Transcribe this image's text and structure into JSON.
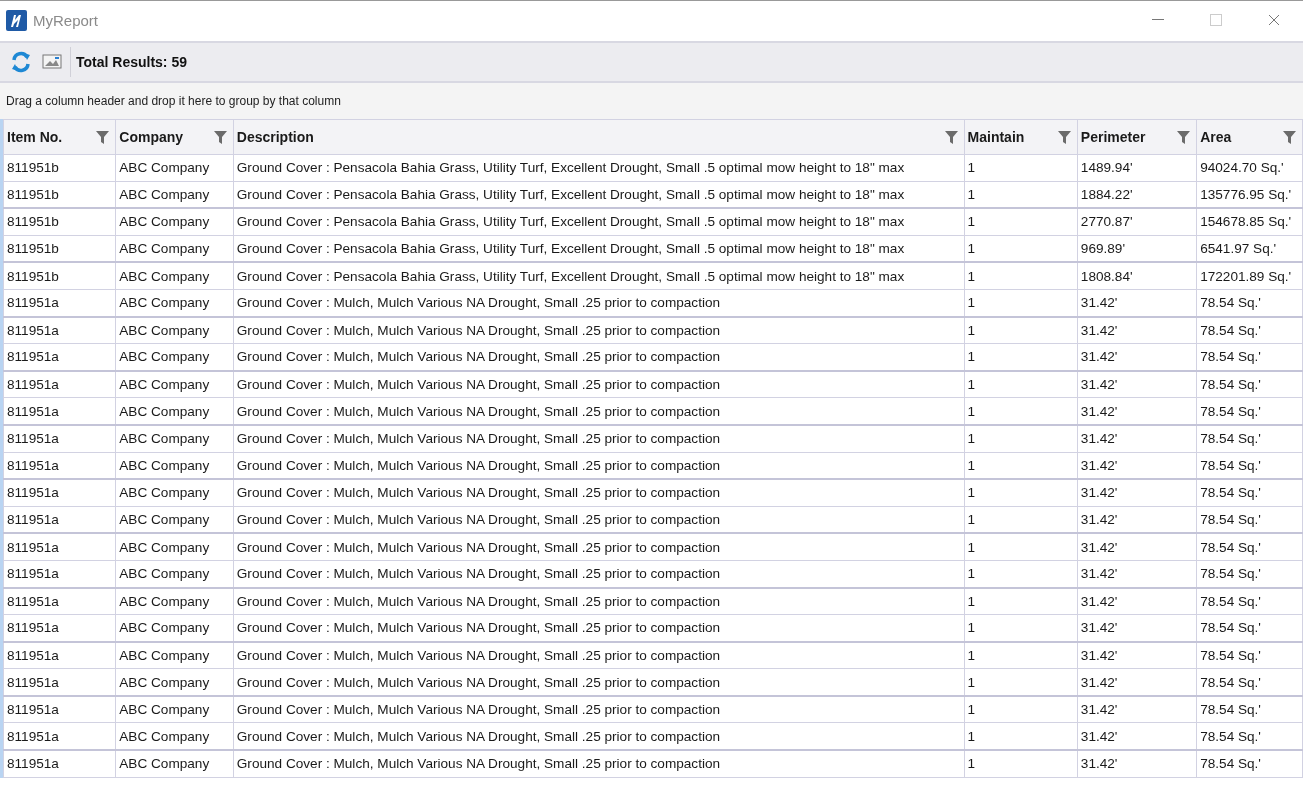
{
  "window": {
    "title": "MyReport"
  },
  "toolbar": {
    "total_results": "Total Results: 59"
  },
  "group_panel": {
    "hint": "Drag a column header and drop it here to group by that column"
  },
  "table": {
    "columns": [
      "Item No.",
      "Company",
      "Description",
      "Maintain",
      "Perimeter",
      "Area"
    ],
    "rows": [
      [
        "811951b",
        "ABC Company",
        "Ground Cover : Pensacola Bahia Grass, Utility Turf, Excellent Drought, Small .5 optimal mow height to 18\" max",
        "1",
        "1489.94'",
        "94024.70 Sq.'"
      ],
      [
        "811951b",
        "ABC Company",
        "Ground Cover : Pensacola Bahia Grass, Utility Turf, Excellent Drought, Small .5 optimal mow height to 18\" max",
        "1",
        "1884.22'",
        "135776.95 Sq.'"
      ],
      [
        "811951b",
        "ABC Company",
        "Ground Cover : Pensacola Bahia Grass, Utility Turf, Excellent Drought, Small .5 optimal mow height to 18\" max",
        "1",
        "2770.87'",
        "154678.85 Sq.'"
      ],
      [
        "811951b",
        "ABC Company",
        "Ground Cover : Pensacola Bahia Grass, Utility Turf, Excellent Drought, Small .5 optimal mow height to 18\" max",
        "1",
        "969.89'",
        "6541.97 Sq.'"
      ],
      [
        "811951b",
        "ABC Company",
        "Ground Cover : Pensacola Bahia Grass, Utility Turf, Excellent Drought, Small .5 optimal mow height to 18\" max",
        "1",
        "1808.84'",
        "172201.89 Sq.'"
      ],
      [
        "811951a",
        "ABC Company",
        "Ground Cover : Mulch, Mulch Various NA Drought, Small .25 prior to compaction",
        "1",
        "31.42'",
        "78.54 Sq.'"
      ],
      [
        "811951a",
        "ABC Company",
        "Ground Cover : Mulch, Mulch Various NA Drought, Small .25 prior to compaction",
        "1",
        "31.42'",
        "78.54 Sq.'"
      ],
      [
        "811951a",
        "ABC Company",
        "Ground Cover : Mulch, Mulch Various NA Drought, Small .25 prior to compaction",
        "1",
        "31.42'",
        "78.54 Sq.'"
      ],
      [
        "811951a",
        "ABC Company",
        "Ground Cover : Mulch, Mulch Various NA Drought, Small .25 prior to compaction",
        "1",
        "31.42'",
        "78.54 Sq.'"
      ],
      [
        "811951a",
        "ABC Company",
        "Ground Cover : Mulch, Mulch Various NA Drought, Small .25 prior to compaction",
        "1",
        "31.42'",
        "78.54 Sq.'"
      ],
      [
        "811951a",
        "ABC Company",
        "Ground Cover : Mulch, Mulch Various NA Drought, Small .25 prior to compaction",
        "1",
        "31.42'",
        "78.54 Sq.'"
      ],
      [
        "811951a",
        "ABC Company",
        "Ground Cover : Mulch, Mulch Various NA Drought, Small .25 prior to compaction",
        "1",
        "31.42'",
        "78.54 Sq.'"
      ],
      [
        "811951a",
        "ABC Company",
        "Ground Cover : Mulch, Mulch Various NA Drought, Small .25 prior to compaction",
        "1",
        "31.42'",
        "78.54 Sq.'"
      ],
      [
        "811951a",
        "ABC Company",
        "Ground Cover : Mulch, Mulch Various NA Drought, Small .25 prior to compaction",
        "1",
        "31.42'",
        "78.54 Sq.'"
      ],
      [
        "811951a",
        "ABC Company",
        "Ground Cover : Mulch, Mulch Various NA Drought, Small .25 prior to compaction",
        "1",
        "31.42'",
        "78.54 Sq.'"
      ],
      [
        "811951a",
        "ABC Company",
        "Ground Cover : Mulch, Mulch Various NA Drought, Small .25 prior to compaction",
        "1",
        "31.42'",
        "78.54 Sq.'"
      ],
      [
        "811951a",
        "ABC Company",
        "Ground Cover : Mulch, Mulch Various NA Drought, Small .25 prior to compaction",
        "1",
        "31.42'",
        "78.54 Sq.'"
      ],
      [
        "811951a",
        "ABC Company",
        "Ground Cover : Mulch, Mulch Various NA Drought, Small .25 prior to compaction",
        "1",
        "31.42'",
        "78.54 Sq.'"
      ],
      [
        "811951a",
        "ABC Company",
        "Ground Cover : Mulch, Mulch Various NA Drought, Small .25 prior to compaction",
        "1",
        "31.42'",
        "78.54 Sq.'"
      ],
      [
        "811951a",
        "ABC Company",
        "Ground Cover : Mulch, Mulch Various NA Drought, Small .25 prior to compaction",
        "1",
        "31.42'",
        "78.54 Sq.'"
      ],
      [
        "811951a",
        "ABC Company",
        "Ground Cover : Mulch, Mulch Various NA Drought, Small .25 prior to compaction",
        "1",
        "31.42'",
        "78.54 Sq.'"
      ],
      [
        "811951a",
        "ABC Company",
        "Ground Cover : Mulch, Mulch Various NA Drought, Small .25 prior to compaction",
        "1",
        "31.42'",
        "78.54 Sq.'"
      ],
      [
        "811951a",
        "ABC Company",
        "Ground Cover : Mulch, Mulch Various NA Drought, Small .25 prior to compaction",
        "1",
        "31.42'",
        "78.54 Sq.'"
      ]
    ]
  }
}
